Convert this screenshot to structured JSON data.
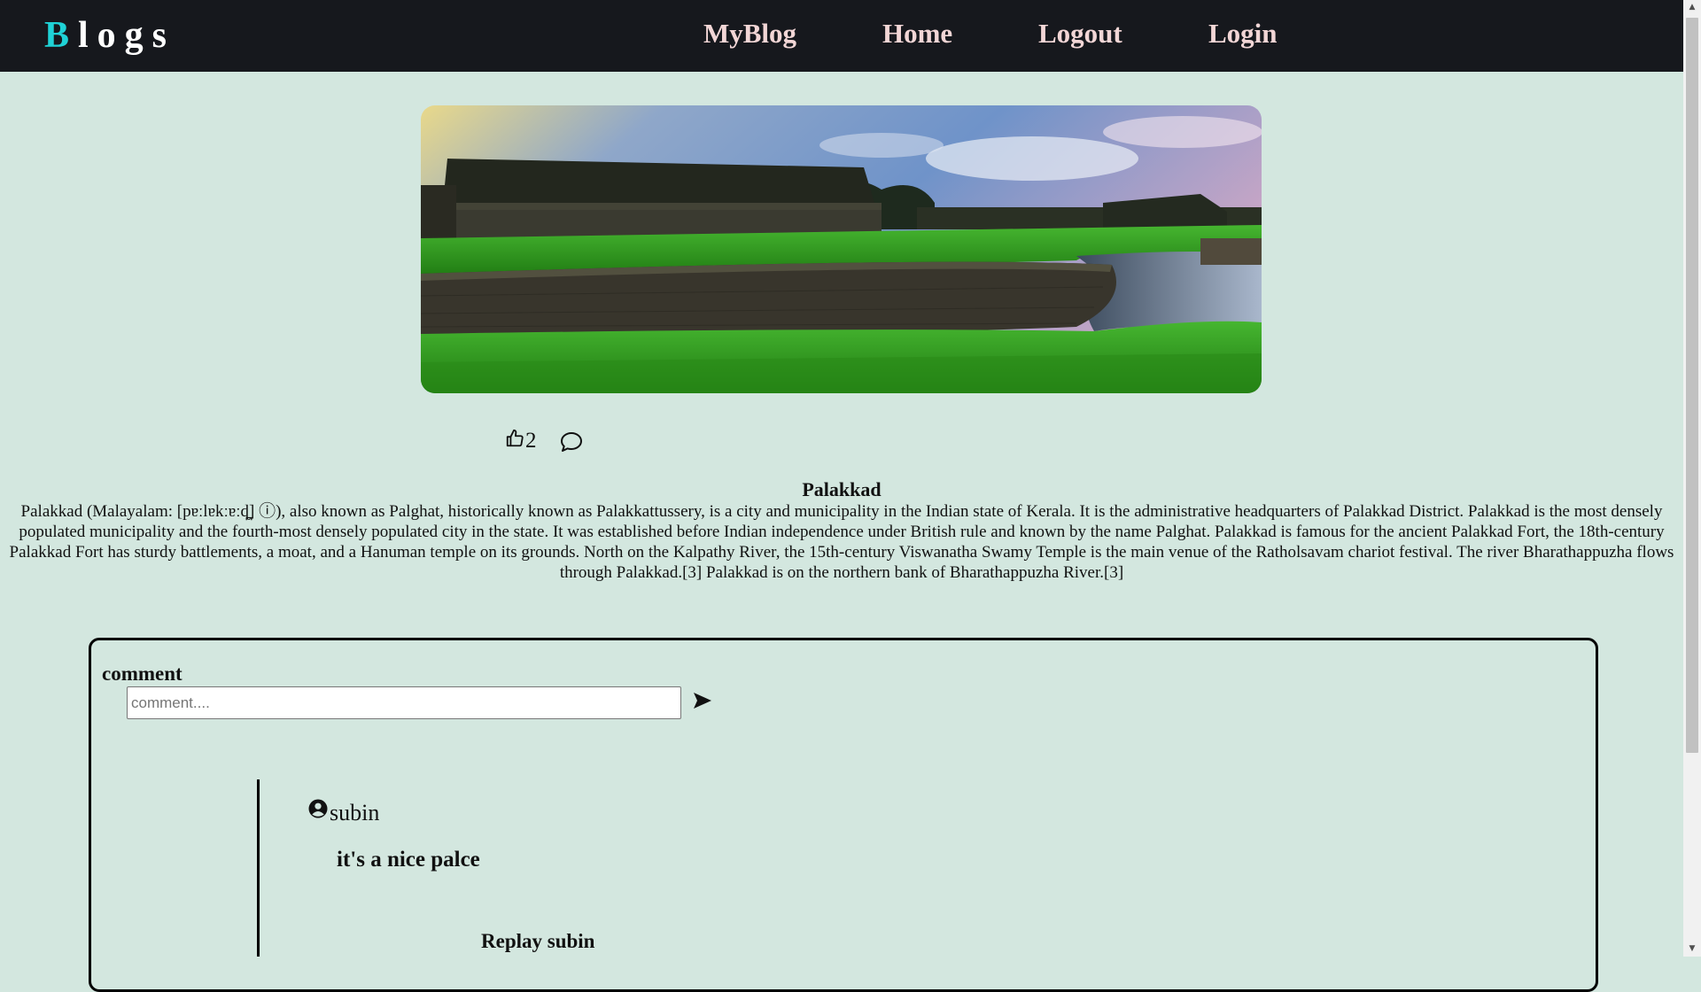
{
  "navbar": {
    "brand_first": "B",
    "brand_rest": "logs",
    "links": [
      "MyBlog",
      "Home",
      "Logout",
      "Login"
    ]
  },
  "post": {
    "likes": "2",
    "title": "Palakkad",
    "body": "Palakkad (Malayalam: [pɐːlɐkːɐːɖ̪] ⓘ), also known as Palghat, historically known as Palakkattussery, is a city and municipality in the Indian state of Kerala. It is the administrative headquarters of Palakkad District. Palakkad is the most densely populated municipality and the fourth-most densely populated city in the state. It was established before Indian independence under British rule and known by the name Palghat. Palakkad is famous for the ancient Palakkad Fort, the 18th-century Palakkad Fort has sturdy battlements, a moat, and a Hanuman temple on its grounds. North on the Kalpathy River, the 15th-century Viswanatha Swamy Temple is the main venue of the Ratholsavam chariot festival. The river Bharathappuzha flows through Palakkad.[3] Palakkad is on the northern bank of Bharathappuzha River.[3]"
  },
  "comments": {
    "label": "comment",
    "input_value": "",
    "input_placeholder": "comment....",
    "items": [
      {
        "author": "subin",
        "text": "it's a nice palce",
        "reply_label": "Replay subin"
      }
    ]
  },
  "colors": {
    "page_background": "#d3e7df",
    "navbar_background": "#16181d",
    "brand_accent": "#1fd2d6",
    "nav_link": "#f2d6d6"
  },
  "icons": {
    "like": "thumbs-up-icon",
    "comment": "speech-bubble-icon",
    "send": "send-arrow-icon",
    "user": "user-circle-icon"
  }
}
